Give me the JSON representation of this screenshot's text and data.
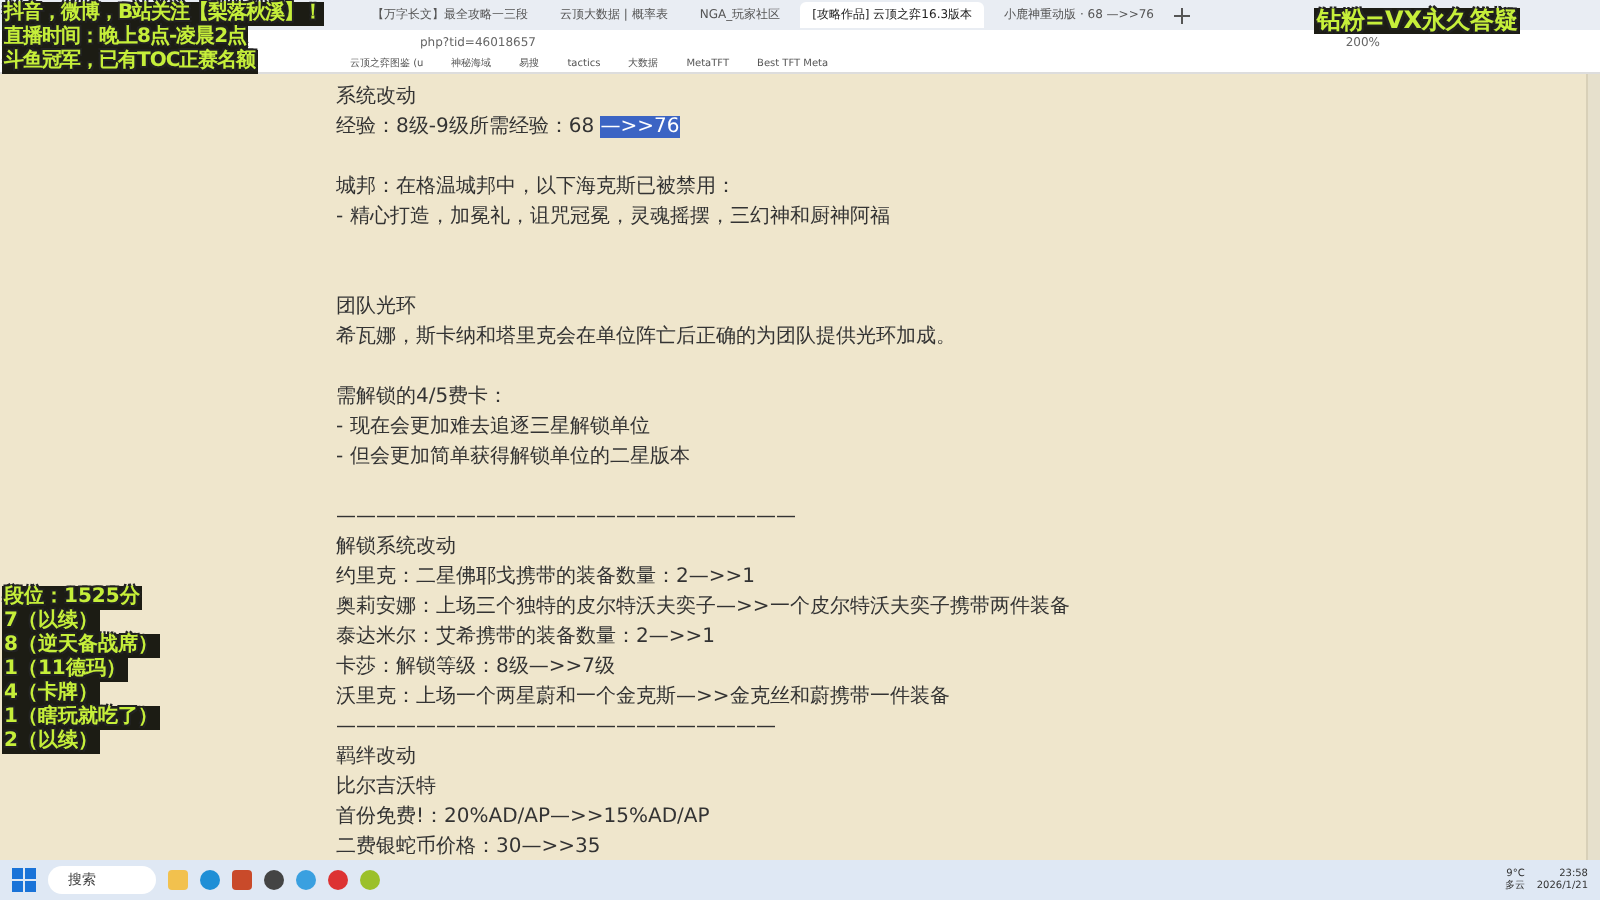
{
  "browser": {
    "tabs": [
      {
        "title": "【万字长文】最全攻略一三段",
        "selected": false
      },
      {
        "title": "云顶大数据 | 概率表",
        "selected": false
      },
      {
        "title": "NGA_玩家社区",
        "selected": false
      },
      {
        "title": "[攻略作品] 云顶之弈16.3版本",
        "selected": true
      },
      {
        "title": "小鹿神重动版 · 68 —>>76",
        "selected": false
      }
    ],
    "address": "php?tid=46018657",
    "zoom": "200%",
    "bookmarks": [
      "云顶之弈图鉴 (u",
      "神秘海域",
      "易搜",
      "tactics",
      "大数据",
      "MetaTFT",
      "Best TFT Meta"
    ]
  },
  "article": {
    "lines": [
      {
        "kind": "text",
        "text": "系统改动"
      },
      {
        "kind": "selection",
        "text": "经验：8级-9级所需经验：68 ",
        "selected_text": "—>>76"
      },
      {
        "kind": "gap"
      },
      {
        "kind": "text",
        "text": "城邦：在格温城邦中，以下海克斯已被禁用："
      },
      {
        "kind": "text",
        "text": "- 精心打造，加冕礼，诅咒冠冕，灵魂摇摆，三幻神和厨神阿福"
      },
      {
        "kind": "gap"
      },
      {
        "kind": "gap"
      },
      {
        "kind": "text",
        "text": "团队光环"
      },
      {
        "kind": "text",
        "text": "希瓦娜，斯卡纳和塔里克会在单位阵亡后正确的为团队提供光环加成。"
      },
      {
        "kind": "gap"
      },
      {
        "kind": "text",
        "text": "需解锁的4/5费卡："
      },
      {
        "kind": "text",
        "text": "- 现在会更加难去追逐三星解锁单位"
      },
      {
        "kind": "text",
        "text": "- 但会更加简单获得解锁单位的二星版本"
      },
      {
        "kind": "gap"
      },
      {
        "kind": "text",
        "text": "———————————————————————"
      },
      {
        "kind": "text",
        "text": "解锁系统改动"
      },
      {
        "kind": "text",
        "text": "约里克：二星佛耶戈携带的装备数量：2—>>1"
      },
      {
        "kind": "text",
        "text": "奥莉安娜：上场三个独特的皮尔特沃夫奕子—>>一个皮尔特沃夫奕子携带两件装备"
      },
      {
        "kind": "text",
        "text": "泰达米尔：艾希携带的装备数量：2—>>1"
      },
      {
        "kind": "text",
        "text": "卡莎：解锁等级：8级—>>7级"
      },
      {
        "kind": "text",
        "text": "沃里克：上场一个两星蔚和一个金克斯—>>金克丝和蔚携带一件装备"
      },
      {
        "kind": "text",
        "text": "——————————————————————"
      },
      {
        "kind": "text",
        "text": "羁绊改动"
      },
      {
        "kind": "text",
        "text": "比尔吉沃特"
      },
      {
        "kind": "text",
        "text": "首份免费!：20%AD/AP—>>15%AD/AP"
      },
      {
        "kind": "text",
        "text": "二费银蛇币价格：30—>>35"
      }
    ]
  },
  "overlays": {
    "top_left": [
      "抖音，微博，B站关注【梨落秋溪】！",
      "直播时间：晚上8点-凌晨2点",
      "斗鱼冠军，已有TOC正赛名额"
    ],
    "top_right": "钻粉=VX永久答疑",
    "rank": [
      "段位：1525分",
      "7（以续）",
      "8（逆天备战席）",
      "1（11德玛）",
      "4（卡牌）",
      "1（瞎玩就吃了）",
      "2（以续）"
    ]
  },
  "taskbar": {
    "search": "搜索",
    "weather_temp": "9°C",
    "weather_text": "多云",
    "time": "23:58",
    "date": "2026/1/21"
  }
}
